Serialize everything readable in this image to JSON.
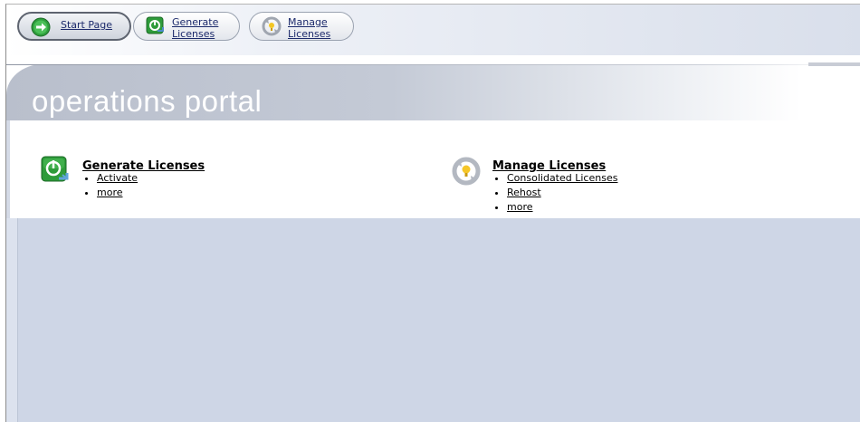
{
  "toolbar": {
    "buttons": [
      {
        "label": "Start Page",
        "icon": "arrow-right-circle-icon",
        "active": true
      },
      {
        "label_line1": "Generate",
        "label_line2": "Licenses",
        "icon": "generate-licenses-icon"
      },
      {
        "label_line1": "Manage",
        "label_line2": "Licenses",
        "icon": "manage-licenses-icon"
      }
    ]
  },
  "header": {
    "title": "operations portal"
  },
  "sections": [
    {
      "title": "Generate Licenses",
      "icon": "generate-licenses-icon",
      "links": [
        "Activate",
        "more"
      ]
    },
    {
      "title": "Manage Licenses",
      "icon": "manage-licenses-icon",
      "links": [
        "Consolidated Licenses",
        "Rehost",
        "more"
      ]
    }
  ],
  "colors": {
    "bottom_background": "#ced6e6",
    "header_band": "#b9bfcc",
    "accent_green": "#2e9b3a",
    "link_blue": "#1c2a6b"
  }
}
